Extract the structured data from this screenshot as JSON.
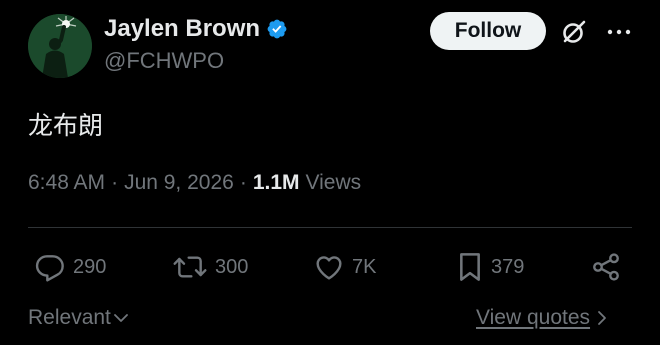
{
  "author": {
    "name": "Jaylen Brown",
    "handle": "@FCHWPO",
    "verified_color": "#1d9bf0"
  },
  "header": {
    "follow_label": "Follow",
    "grok_icon": "grok-icon",
    "more_icon": "more-icon"
  },
  "post": {
    "text": "龙布朗",
    "time": "6:48 AM",
    "date": "Jun 9, 2026",
    "views_count": "1.1M",
    "views_label": "Views"
  },
  "actions": {
    "replies": "290",
    "reposts": "300",
    "likes": "7K",
    "bookmarks": "379"
  },
  "footer": {
    "sort_label": "Relevant",
    "quotes_label": "View quotes"
  },
  "colors": {
    "background": "#000000",
    "primary_text": "#e7e9ea",
    "secondary_text": "#71767b",
    "divider": "#2f3336",
    "follow_bg": "#eff3f4"
  }
}
